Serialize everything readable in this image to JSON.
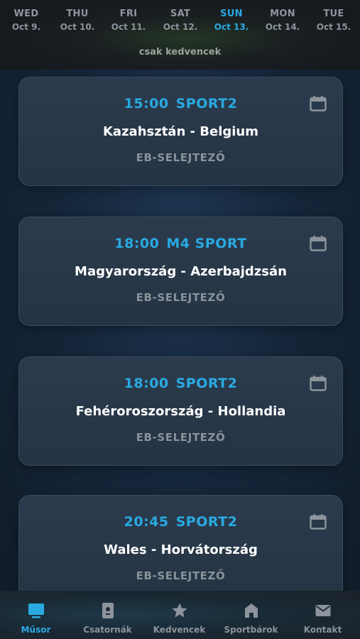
{
  "days": [
    {
      "name": "WED",
      "date": "Oct 9."
    },
    {
      "name": "THU",
      "date": "Oct 10."
    },
    {
      "name": "FRI",
      "date": "Oct 11."
    },
    {
      "name": "SAT",
      "date": "Oct 12."
    },
    {
      "name": "SUN",
      "date": "Oct 13."
    },
    {
      "name": "MON",
      "date": "Oct 14."
    },
    {
      "name": "TUE",
      "date": "Oct 15."
    }
  ],
  "selected_day": "SUN",
  "favorites_filter": "csak kedvencek",
  "matches": [
    {
      "time": "15:00",
      "channel": "SPORT2",
      "teams": "Kazahsztán - Belgium",
      "competition": "EB-SELEJTEZŐ",
      "icon": "calendar-icon"
    },
    {
      "time": "18:00",
      "channel": "M4 SPORT",
      "teams": "Magyarország - Azerbajdzsán",
      "competition": "EB-SELEJTEZŐ",
      "icon": "calendar-icon"
    },
    {
      "time": "18:00",
      "channel": "SPORT2",
      "teams": "Fehéroroszország - Hollandia",
      "competition": "EB-SELEJTEZŐ",
      "icon": "calendar-icon"
    },
    {
      "time": "20:45",
      "channel": "SPORT2",
      "teams": "Wales - Horvátország",
      "competition": "EB-SELEJTEZŐ",
      "icon": "calendar-icon"
    }
  ],
  "tabs": [
    {
      "label": "Műsor",
      "icon": "tv-icon"
    },
    {
      "label": "Csatornák",
      "icon": "remote-icon"
    },
    {
      "label": "Kedvencek",
      "icon": "star-icon"
    },
    {
      "label": "Sportbárok",
      "icon": "home-icon"
    },
    {
      "label": "Kontakt",
      "icon": "mail-icon"
    }
  ],
  "active_tab": "Műsor",
  "colors": {
    "accent": "#29aae2",
    "muted": "#8d949c",
    "card": "#2b3b4d"
  }
}
